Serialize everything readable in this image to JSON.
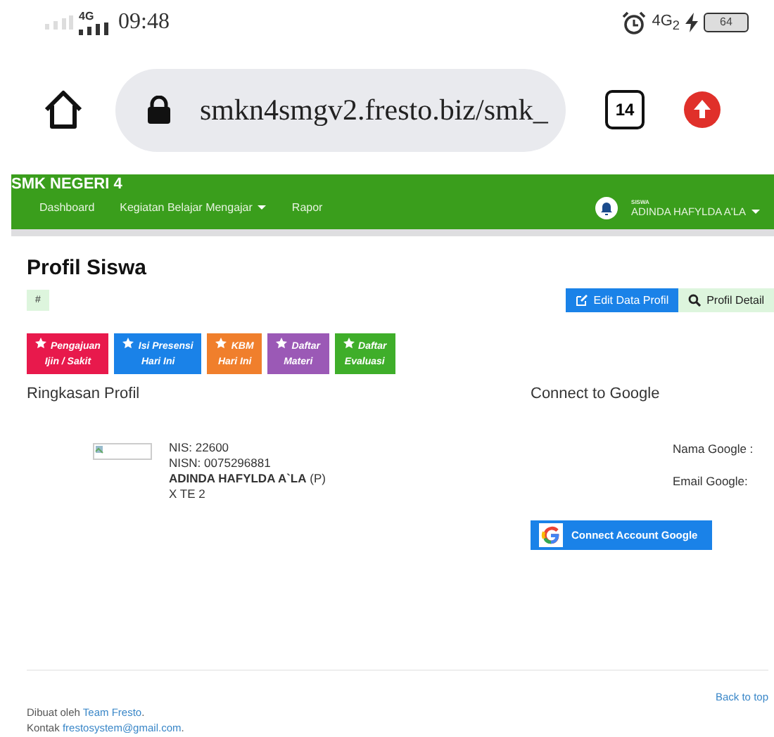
{
  "status_bar": {
    "network": "4G",
    "time": "09:48",
    "network_right": "4G$_{2}$",
    "battery": "64"
  },
  "browser": {
    "url": "smkn4smgv2.fresto.biz/smk_",
    "tab_count": "14"
  },
  "navbar": {
    "brand": "SMK NEGERI 4",
    "items": [
      {
        "label": "Dashboard",
        "dropdown": false
      },
      {
        "label": "Kegiatan Belajar Mengajar",
        "dropdown": true
      },
      {
        "label": "Rapor",
        "dropdown": false
      }
    ],
    "role": "SISWA",
    "user": "ADINDA HAFYLDA A'LA",
    "user_dropdown": true
  },
  "page": {
    "title": "Profil Siswa",
    "badge": "#",
    "buttons": [
      {
        "kind": "edit",
        "label": "Edit Data Profil"
      },
      {
        "kind": "detail",
        "label": "Profil Detail"
      }
    ],
    "actions": [
      {
        "label": "Pengajuan\nIjin / Sakit",
        "color": "#e8194c"
      },
      {
        "label": "Isi Presensi\nHari Ini",
        "color": "#1a82e8"
      },
      {
        "label": "KBM\nHari Ini",
        "color": "#f07f2c"
      },
      {
        "label": "Daftar\nMateri",
        "color": "#9b59b6"
      },
      {
        "label": "Daftar\nEvaluasi",
        "color": "#3fae2a"
      }
    ]
  },
  "profile": {
    "heading": "Ringkasan Profil",
    "lines": [
      "NIS: 22600",
      "NISN: 0075296881",
      "**ADINDA HAFYLDA A`LA** (P)",
      "X TE 2"
    ]
  },
  "google": {
    "heading": "Connect to Google",
    "fields": [
      "Nama Google :",
      "Email Google:"
    ],
    "button": "Connect Account Google"
  },
  "footer": {
    "back_to_top": "Back to top",
    "lines": [
      {
        "text": "Dibuat oleh",
        "link": "Team Fresto",
        "after": "."
      },
      {
        "text": "Kontak",
        "link": "frestosystem@gmail.com",
        "after": "."
      }
    ]
  }
}
